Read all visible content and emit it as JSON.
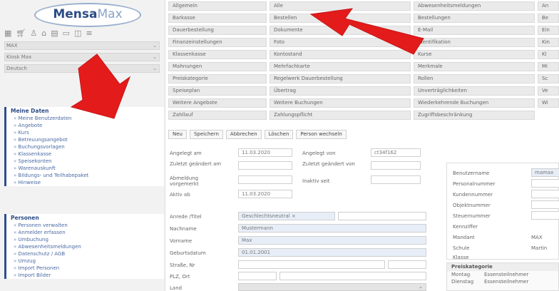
{
  "app": {
    "logo_main": "Mensa",
    "logo_accent": "Max"
  },
  "sidebar": {
    "toolbar_icons": [
      "grid-icon",
      "cart-icon",
      "user-icon",
      "building-icon",
      "chart-icon",
      "card-icon",
      "door-icon",
      "menu-icon"
    ],
    "selects": [
      "MAX",
      "Kiosk Max",
      "Deutsch"
    ],
    "groups": [
      {
        "title": "Meine Daten",
        "items": [
          "Meine Benutzerdaten",
          "Angebote",
          "Kurs",
          "Betreuungsangebot",
          "Buchungsvorlagen",
          "Klassenkasse",
          "Speisekonten",
          "Warenauskunft",
          "Bildungs- und Teilhabepaket",
          "Hinweise"
        ]
      },
      {
        "title": "Personen",
        "items": [
          "Personen verwalten",
          "Anmelder erfassen",
          "Umbuchung",
          "Abwesenheitsmeldungen",
          "Datenschutz / AGB",
          "Umzug",
          "Import Personen",
          "Import Bilder"
        ]
      }
    ]
  },
  "menu": {
    "columns": [
      [
        "Allgemein",
        "Barkasse",
        "Dauerbestellung",
        "Finanzeinstellungen",
        "Klassenkasse",
        "Mahnungen",
        "Preiskategorie",
        "Speiseplan",
        "Weitere Angebote",
        "Zahllauf"
      ],
      [
        "Alle",
        "Bestellen",
        "Dokumente",
        "Foto",
        "Kontostand",
        "Mehrfachkarte",
        "Regelwerk Dauerbestellung",
        "Übertrag",
        "Weitere Buchungen",
        "Zahlungspflicht"
      ],
      [
        "Abwesenheitsmeldungen",
        "Bestellungen",
        "E-Mail",
        "Identifikation",
        "Kurse",
        "Merkmale",
        "Rollen",
        "Unverträglichkeiten",
        "Wiederkehrende Buchungen",
        "Zugriffsbeschränkung"
      ],
      [
        "An",
        "Be",
        "Ein",
        "Kin",
        "Kl",
        "Mi",
        "Sc",
        "Ve",
        "Wi",
        ""
      ]
    ]
  },
  "actions": [
    "Neu",
    "Speichern",
    "Abbrechen",
    "Löschen",
    "Person wechseln"
  ],
  "form": {
    "created_on_label": "Angelegt am",
    "created_on_value": "11.03.2020",
    "created_by_label": "Angelegt von",
    "created_by_value": "ct34f162",
    "changed_on_label": "Zuletzt geändert am",
    "changed_by_label": "Zuletzt geändert von",
    "cancel_label": "Abmeldung vorgemerkt",
    "inactive_label": "Inaktiv seit",
    "active_from_label": "Aktiv ab",
    "active_from_value": "11.03.2020",
    "salutation_label": "Anrede /Titel",
    "salutation_value": "Geschlechtsneutral",
    "lastname_label": "Nachname",
    "lastname_value": "Mustermann",
    "firstname_label": "Vorname",
    "firstname_value": "Max",
    "birthdate_label": "Geburtsdatum",
    "birthdate_value": "01.01.2001",
    "street_label": "Straße, Nr",
    "zip_label": "PLZ, Ort",
    "country_label": "Land"
  },
  "right_panel": {
    "labels": [
      "Benutzername",
      "Personalnummer",
      "Kundennummer",
      "Objektnummer",
      "Steuernummer",
      "Kennziffer",
      "Mandant",
      "Schule",
      "Klasse"
    ],
    "values": [
      "mamax",
      "",
      "",
      "",
      "",
      "",
      "MAX",
      "Martin",
      ""
    ]
  },
  "price_panel": {
    "title": "Preiskategorie",
    "rows": [
      [
        "Montag",
        "Essensteilnehmer"
      ],
      [
        "Dienstag",
        "Essensteilnehmer"
      ]
    ]
  },
  "colors": {
    "arrow": "#e41b1b",
    "accent": "#2c4c86"
  }
}
